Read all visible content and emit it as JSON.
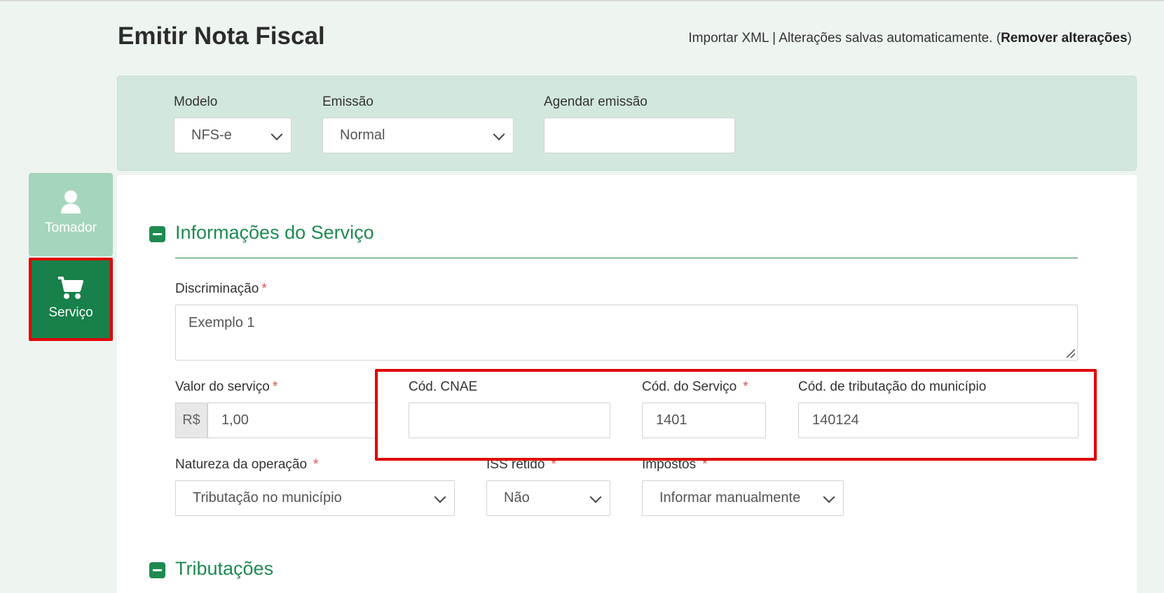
{
  "page": {
    "title": "Emitir Nota Fiscal",
    "import_xml": "Importar XML",
    "separator": "|",
    "autosave_text": "Alterações salvas automaticamente. (",
    "remove_changes": "Remover alterações",
    "close_paren": ")"
  },
  "header": {
    "modelo_label": "Modelo",
    "modelo_value": "NFS-e",
    "emissao_label": "Emissão",
    "emissao_value": "Normal",
    "agendar_label": "Agendar emissão",
    "agendar_value": ""
  },
  "sidebar": {
    "tomador_label": "Tomador",
    "servico_label": "Serviço"
  },
  "servico_section": {
    "title": "Informações do Serviço",
    "discriminacao_label": "Discriminação",
    "discriminacao_value": "Exemplo 1",
    "valor_label": "Valor do serviço",
    "currency": "R$",
    "valor_value": "1,00",
    "cnae_label": "Cód. CNAE",
    "cnae_value": "",
    "cod_servico_label": "Cód. do Serviço",
    "cod_servico_value": "1401",
    "cod_tributacao_label": "Cód. de tributação do município",
    "cod_tributacao_value": "140124",
    "natureza_label": "Natureza da operação",
    "natureza_value": "Tributação no município",
    "iss_label": "ISS retido",
    "iss_value": "Não",
    "impostos_label": "Impostos",
    "impostos_value": "Informar manualmente",
    "required_mark": "*"
  },
  "tributacoes_section": {
    "title": "Tributações"
  },
  "colors": {
    "accent_green": "#1e8a50",
    "highlight_red": "#e00000"
  }
}
